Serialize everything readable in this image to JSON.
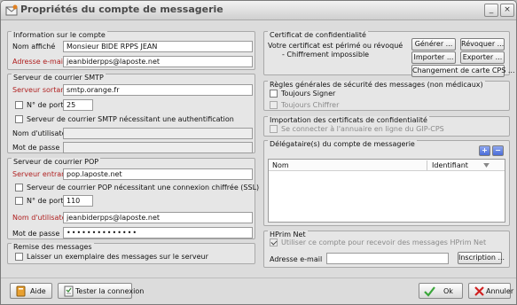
{
  "window": {
    "title": "Propriétés du compte de messagerie",
    "minimize_glyph": "_",
    "close_glyph": "×"
  },
  "account_info": {
    "title": "Information sur le compte",
    "display_name_label": "Nom affiché",
    "display_name_value": "Monsieur BIDE RPPS JEAN",
    "email_label": "Adresse e-mail",
    "email_value": "jeanbiderpps@laposte.net"
  },
  "smtp": {
    "title": "Serveur de courrier SMTP",
    "server_label": "Serveur sortant",
    "server_value": "smtp.orange.fr",
    "port_label": "N° de port",
    "port_value": "25",
    "auth_label": "Serveur de courrier SMTP nécessitant une authentification",
    "username_label": "Nom d'utilisateur",
    "username_value": "",
    "password_label": "Mot de passe",
    "password_value": ""
  },
  "pop": {
    "title": "Serveur de courrier POP",
    "server_label": "Serveur entrant",
    "server_value": "pop.laposte.net",
    "ssl_label": "Serveur de courrier POP nécessitant une connexion chiffrée (SSL)",
    "port_label": "N° de port",
    "port_value": "110",
    "username_label": "Nom d'utilisateur",
    "username_value": "jeanbiderpps@laposte.net",
    "password_label": "Mot de passe",
    "password_value": "••••••••••••••"
  },
  "delivery": {
    "title": "Remise des messages",
    "keep_copy_label": "Laisser un exemplaire des messages sur le serveur"
  },
  "certificate": {
    "title": "Certificat de confidentialité",
    "status_line1": "Votre certificat est périmé ou révoqué",
    "status_line2": "- Chiffrement impossible",
    "generate_label": "Générer ...",
    "revoke_label": "Révoquer ...",
    "import_label": "Importer ...",
    "export_label": "Exporter ...",
    "change_cps_label": "Changement de carte CPS ..."
  },
  "security_rules": {
    "title": "Règles générales de sécurité des messages (non médicaux)",
    "always_sign_label": "Toujours Signer",
    "always_encrypt_label": "Toujours Chiffrer"
  },
  "cert_import": {
    "title": "Importation des certificats de confidentialité",
    "connect_label": "Se connecter à l'annuaire en ligne du GIP-CPS"
  },
  "delegates": {
    "title": "Délégataire(s) du compte de messagerie",
    "columns": [
      "Nom",
      "Identifiant"
    ],
    "add_glyph": "+",
    "remove_glyph": "−"
  },
  "hprim": {
    "title": "HPrim Net",
    "use_account_label": "Utiliser ce compte pour recevoir des messages HPrim Net",
    "email_label": "Adresse e-mail",
    "email_value": "",
    "register_label": "Inscription ..."
  },
  "footer": {
    "help_label": "Aide",
    "test_label": "Tester la connexion",
    "ok_label": "Ok",
    "cancel_label": "Annuler"
  },
  "colors": {
    "required_label": "#b02020",
    "ok_check": "#3aa63a",
    "cancel_x": "#d02020"
  }
}
